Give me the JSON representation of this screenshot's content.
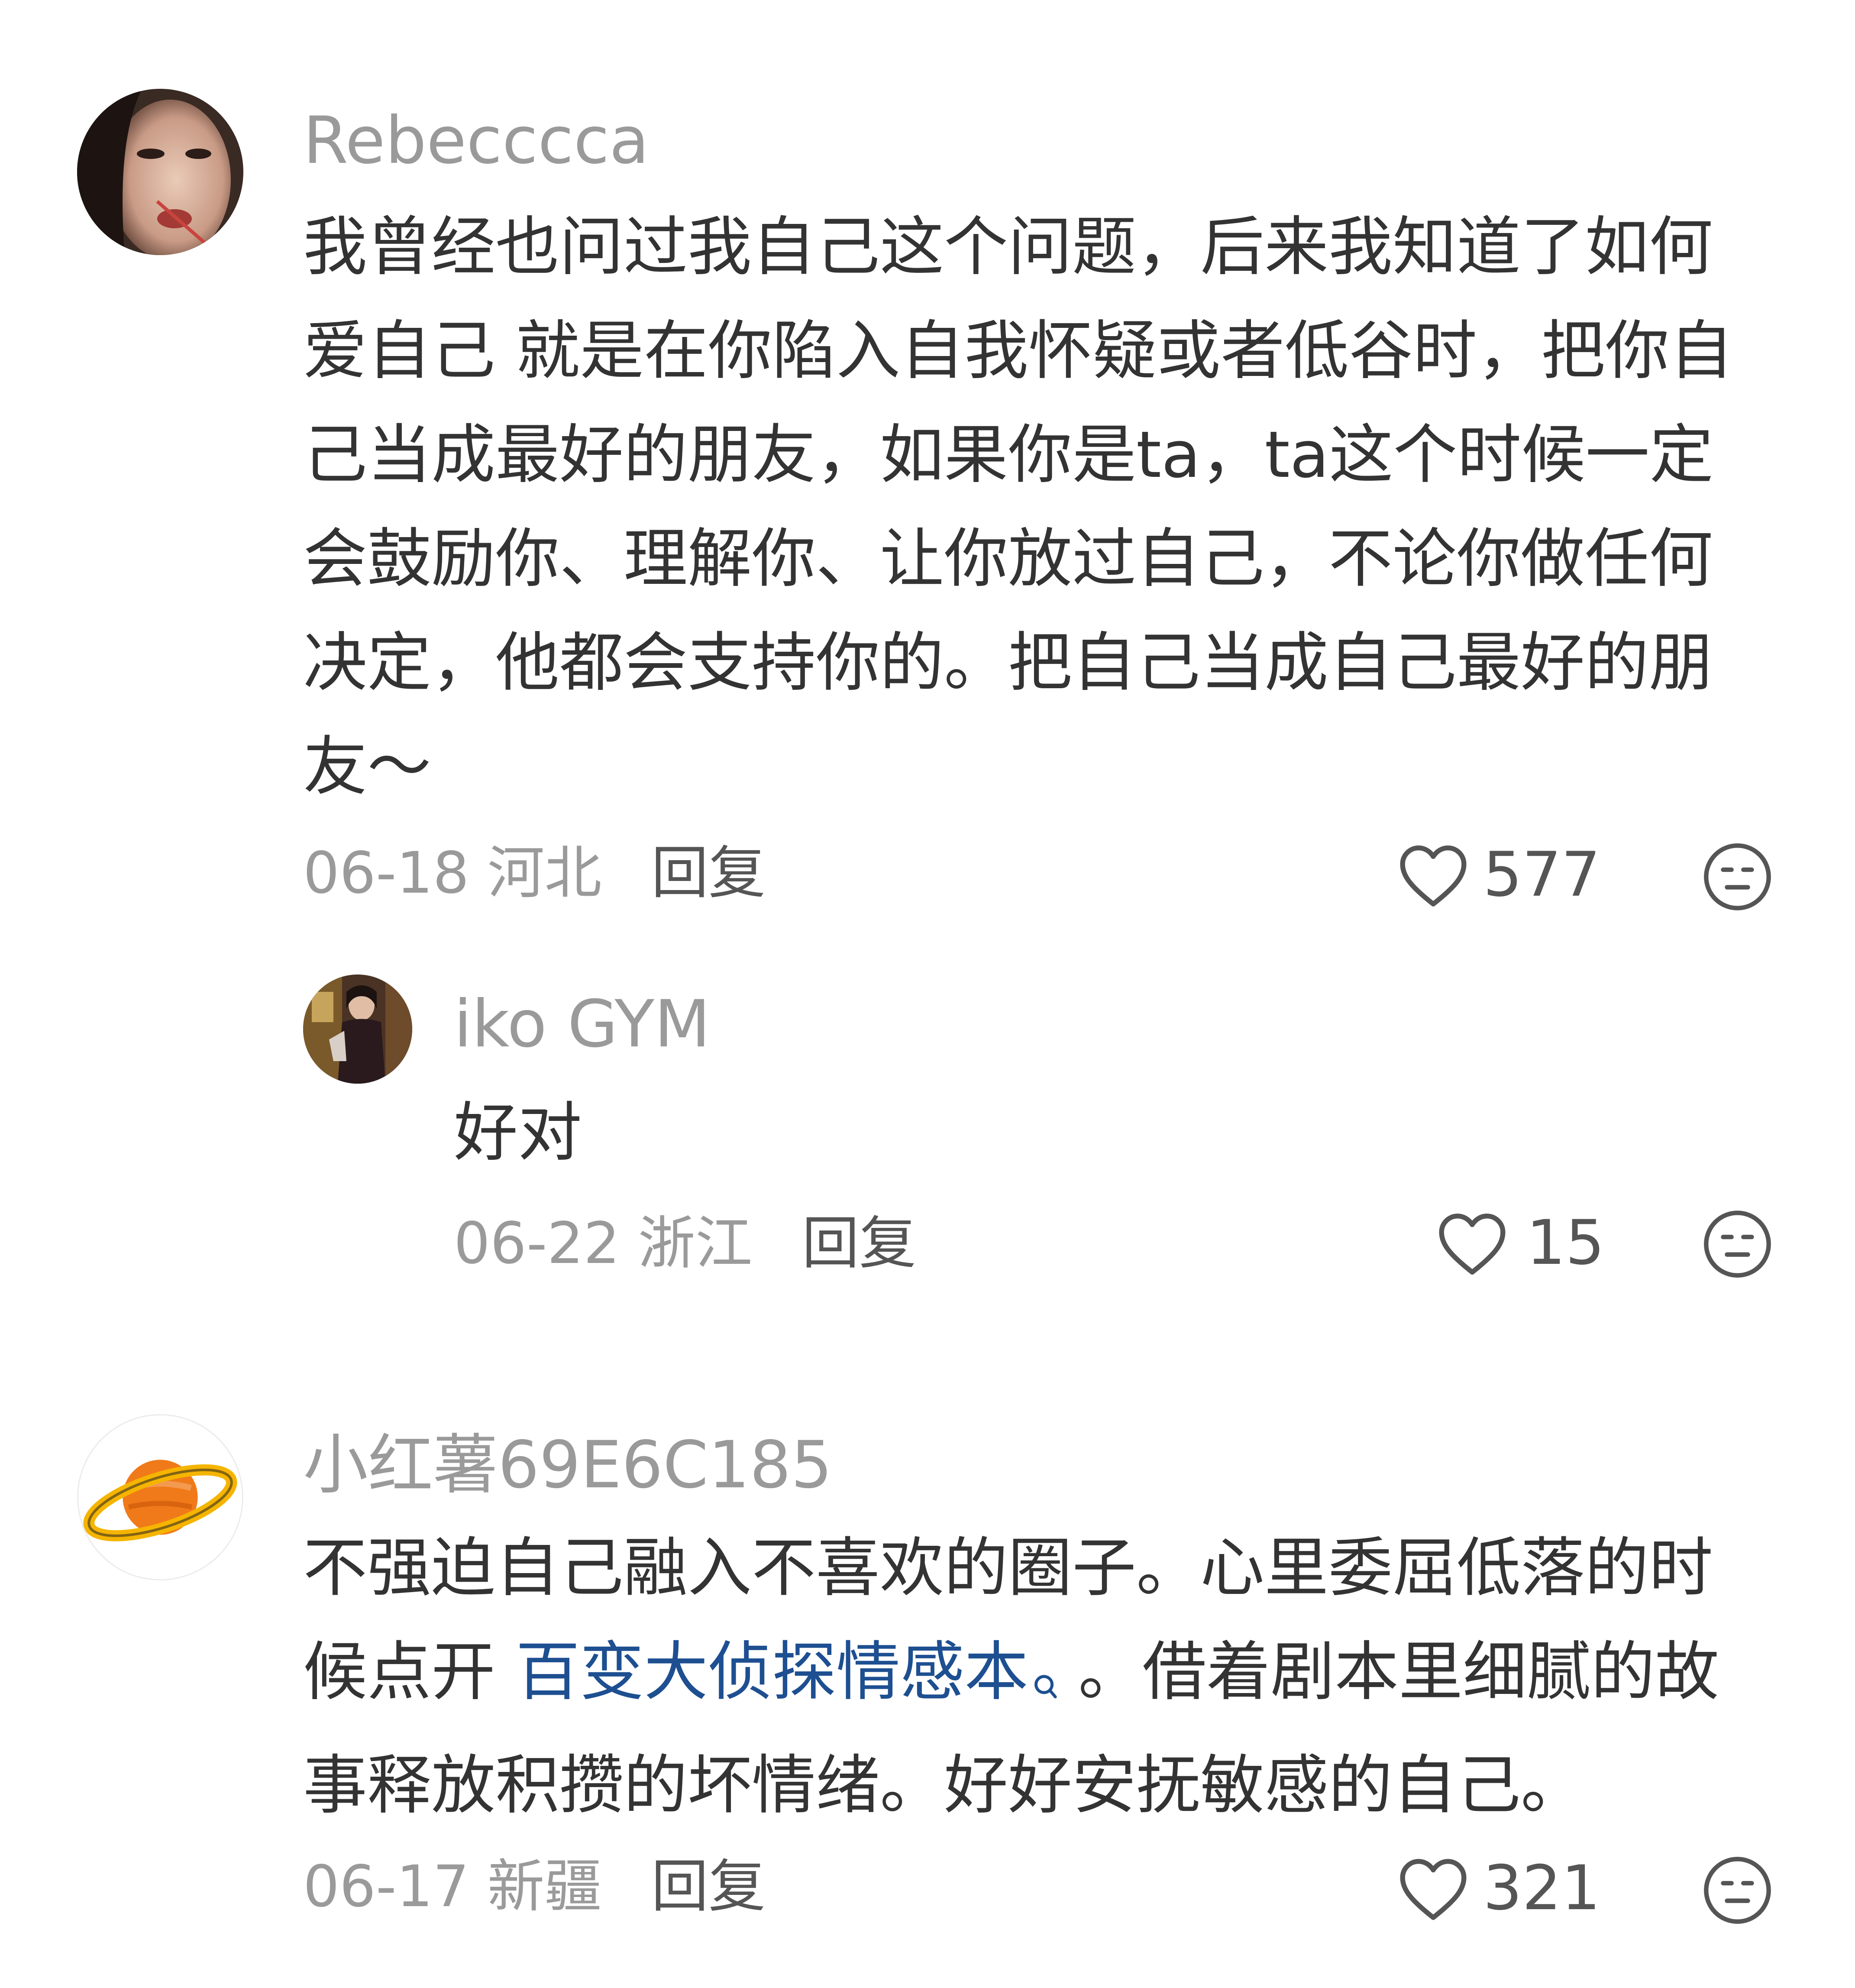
{
  "comments": [
    {
      "username": "Rebecccca",
      "content_lines": [
        "我曾经也问过我自己这个问题，后来我知道了如何",
        "爱自己 就是在你陷入自我怀疑或者低谷时，把你自",
        "己当成最好的朋友，如果你是ta，ta这个时候一定",
        "会鼓励你、理解你、让你放过自己，不论你做任何",
        "决定，他都会支持你的。把自己当成自己最好的朋",
        "友～"
      ],
      "date": "06-18",
      "location": "河北",
      "reply_label": "回复",
      "likes": "577",
      "avatar_icon": "portrait-avatar"
    },
    {
      "username": "iko GYM",
      "content": "好对",
      "date": "06-22",
      "location": "浙江",
      "reply_label": "回复",
      "likes": "15",
      "avatar_icon": "portrait-avatar"
    },
    {
      "username": "小红薯69E6C185",
      "content_line1": "不强迫自己融入不喜欢的圈子。心里委屈低落的时",
      "content_line2_prefix": "候点开 ",
      "content_line2_link": "百变大侦探情感本",
      "content_line2_suffix": " 。借着剧本里细腻的故",
      "content_line3": "事释放积攒的坏情绪。好好安抚敏感的自己。",
      "date": "06-17",
      "location": "新疆",
      "reply_label": "回复",
      "likes": "321",
      "avatar_icon": "planet-avatar"
    }
  ],
  "icons": {
    "like": "heart-outline-icon",
    "emoji": "neutral-face-icon",
    "link_search": "search-small-icon"
  },
  "colors": {
    "link": "#1d4f91",
    "username": "#9a9a9a",
    "text": "#333333",
    "planet_orange": "#f07a1a",
    "planet_ring": "#f5b400"
  }
}
